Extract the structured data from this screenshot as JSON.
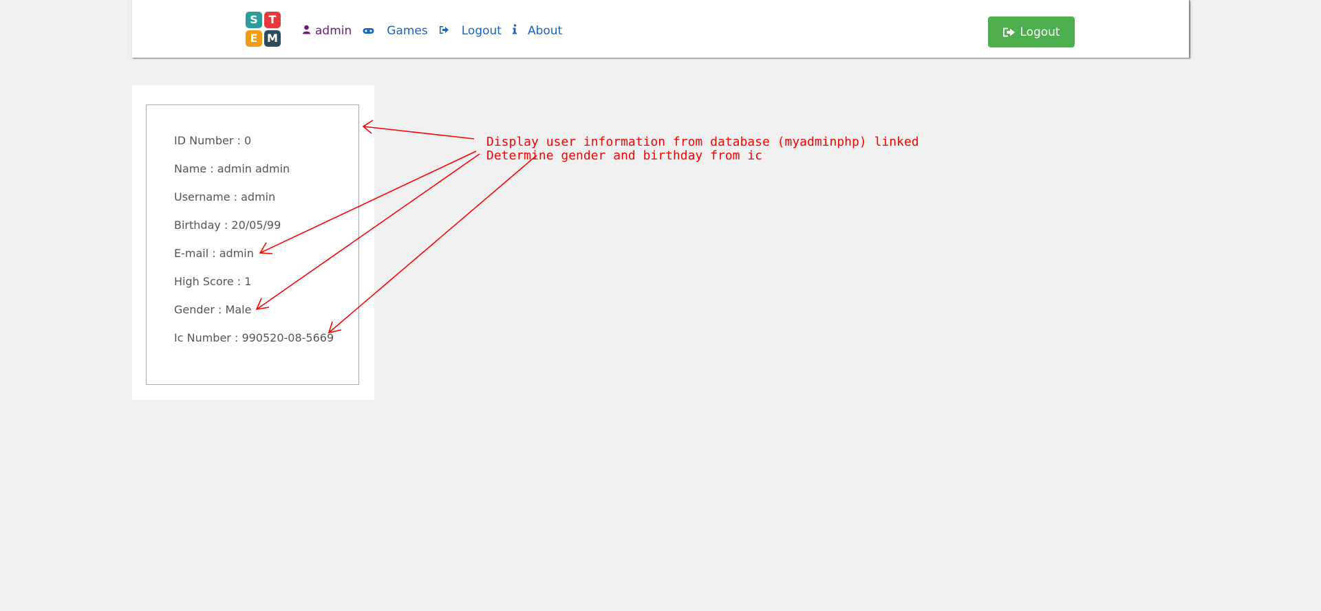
{
  "logo": {
    "letters": [
      "S",
      "T",
      "E",
      "M"
    ],
    "colors": [
      "#2a9d9b",
      "#e8373d",
      "#f39c12",
      "#2c4a5a"
    ]
  },
  "nav": {
    "admin_label": "admin",
    "games_label": "Games",
    "logout_label": "Logout",
    "about_label": "About"
  },
  "logout_button": {
    "label": "Logout",
    "color": "#4cae4c"
  },
  "user_info": [
    {
      "label": "ID Number : 0"
    },
    {
      "label": "Name : admin admin"
    },
    {
      "label": "Username : admin"
    },
    {
      "label": "Birthday : 20/05/99"
    },
    {
      "label": "E-mail : admin"
    },
    {
      "label": "High Score : 1"
    },
    {
      "label": "Gender : Male"
    },
    {
      "label": "Ic Number : 990520-08-5669"
    }
  ],
  "annotations": {
    "line1": "Display user information from database (myadminphp) linked",
    "line2": "Determine gender and birthday from ic",
    "color": "#ff0000"
  }
}
